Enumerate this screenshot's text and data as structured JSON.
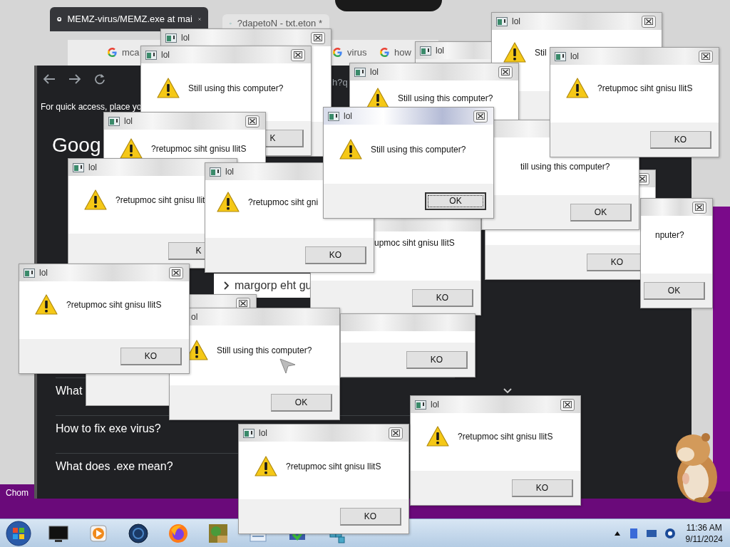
{
  "browser": {
    "tabs": [
      {
        "title": "MEMZ-virus/MEMZ.exe at mai",
        "selected": true
      },
      {
        "title": "?dapetoN - txt.eton *",
        "selected": false
      }
    ],
    "inner_tabs": [
      "mca",
      "virus",
      "how"
    ],
    "address_fragment": "h?q",
    "bookmark_hint": "For quick access, place yo",
    "logo": "Goog",
    "results": [
      "What",
      "How to fix exe virus?",
      "What does .exe mean?"
    ],
    "overlay_text": "margorp eht gu",
    "taskbar_label": "Chom"
  },
  "dialogs": [
    {
      "title": "lol",
      "active": false
    },
    {
      "title": "lol",
      "message": "Still using this computer?",
      "button": "K",
      "active": false
    },
    {
      "title": "lol",
      "active": false
    },
    {
      "title": "lol",
      "message": "Stil",
      "active": false
    },
    {
      "title": "lol",
      "message": "Still using this computer?",
      "active": false
    },
    {
      "title": "lol",
      "message": "?retupmoc siht gnisu llitS",
      "active": false
    },
    {
      "button": "KO",
      "active": false
    },
    {
      "message": "nputer?",
      "button": "OK",
      "active": false
    },
    {
      "message": "till using this computer?",
      "button": "OK",
      "active": false
    },
    {
      "title": "lol",
      "message": "?retupmoc siht gnisu llitS",
      "button": "KO",
      "active": false
    },
    {
      "title": "lol",
      "message": "?retupmoc siht gnisu llit",
      "button": "K",
      "active": false
    },
    {
      "message": "upmoc siht gnisu llitS",
      "button": "KO",
      "active": false
    },
    {
      "title": "lol",
      "message": "?retupmoc siht gni",
      "button": "KO",
      "active": false
    },
    {
      "title": "lol",
      "message": "Still using this computer?",
      "button": "OK",
      "active": true
    },
    {
      "active": false
    },
    {
      "title": "ol",
      "message": "Still using this computer?",
      "button": "OK",
      "active": false
    },
    {
      "button": "KO",
      "active": false
    },
    {
      "title": "lol",
      "message": "?retupmoc siht gnisu llitS",
      "button": "KO",
      "active": false
    },
    {
      "title": "lol",
      "message": "?retupmoc siht gnisu llitS",
      "button": "KO",
      "active": false
    },
    {
      "title": "lol",
      "message": "?retupmoc siht gnisu llitS",
      "button": "KO",
      "active": false
    }
  ],
  "taskbar": {
    "time": "11:36 AM",
    "date": "9/11/2024"
  }
}
